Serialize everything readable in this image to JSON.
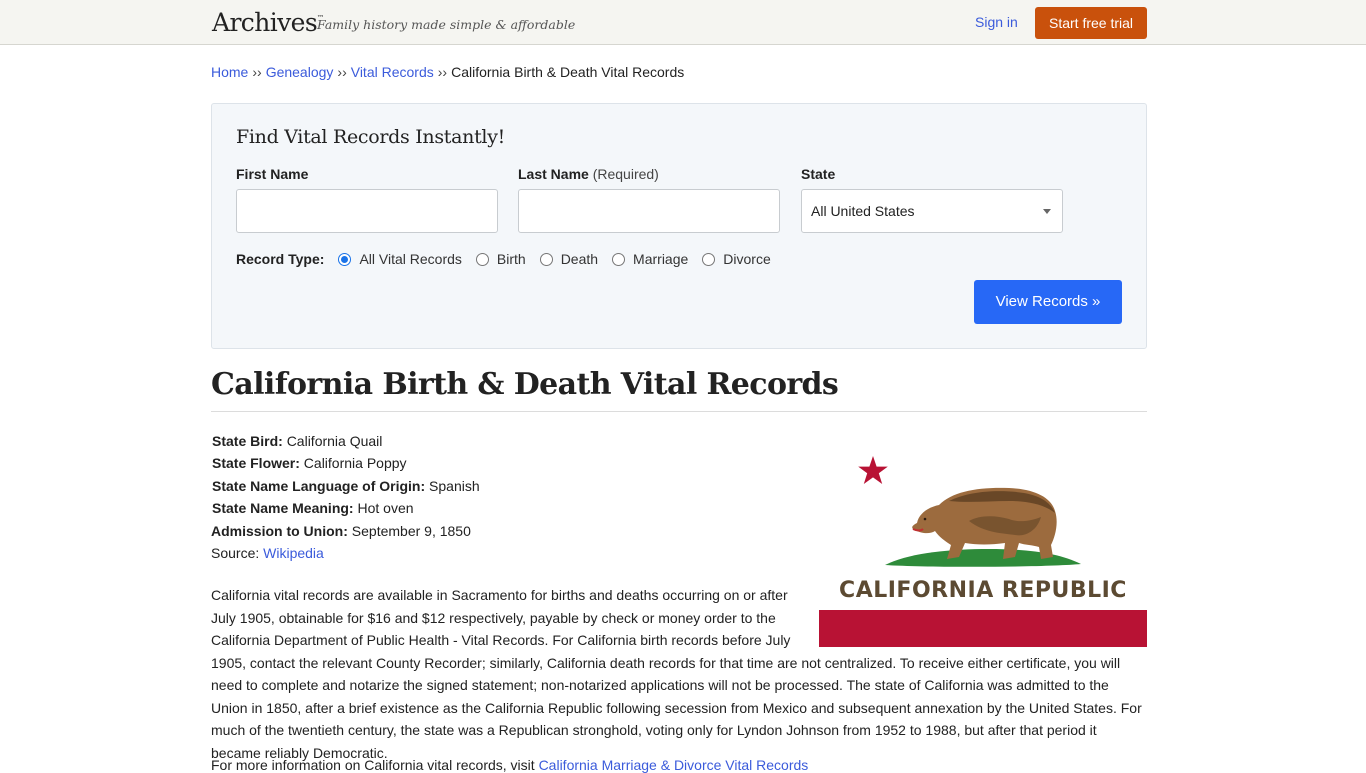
{
  "header": {
    "logo": "Archives",
    "logo_tm": "™",
    "tagline": "Family history made simple & affordable",
    "sign_in": "Sign in",
    "start_trial": "Start free trial",
    "colors": {
      "trial_button": "#c9510c",
      "link": "#3b5bdb"
    }
  },
  "breadcrumb": {
    "separator": "››",
    "items": [
      {
        "label": "Home",
        "link": true
      },
      {
        "label": "Genealogy",
        "link": true
      },
      {
        "label": "Vital Records",
        "link": true
      },
      {
        "label": "California Birth & Death Vital Records",
        "link": false
      }
    ]
  },
  "search": {
    "title": "Find Vital Records Instantly!",
    "first_name": {
      "label": "First Name",
      "value": "",
      "placeholder": ""
    },
    "last_name": {
      "label": "Last Name",
      "hint": "(Required)",
      "value": "",
      "placeholder": ""
    },
    "state": {
      "label": "State",
      "selected": "All United States",
      "icon": "chevron-down-icon"
    },
    "record_type": {
      "label": "Record Type:",
      "options": [
        {
          "label": "All Vital Records",
          "checked": true
        },
        {
          "label": "Birth",
          "checked": false
        },
        {
          "label": "Death",
          "checked": false
        },
        {
          "label": "Marriage",
          "checked": false
        },
        {
          "label": "Divorce",
          "checked": false
        }
      ]
    },
    "submit": "View Records »",
    "colors": {
      "submit_button": "#2768f6"
    }
  },
  "page": {
    "title": "California Birth & Death Vital Records",
    "facts": [
      {
        "label": "State Bird:",
        "value": "California Quail"
      },
      {
        "label": "State Flower:",
        "value": "California Poppy"
      },
      {
        "label": "State Name Language of Origin:",
        "value": "Spanish"
      },
      {
        "label": "State Name Meaning:",
        "value": "Hot oven"
      },
      {
        "label": "Admission to Union:",
        "value": "September 9, 1850"
      }
    ],
    "source_label": "Source:",
    "source_link": "Wikipedia",
    "flag": {
      "caption": "CALIFORNIA REPUBLIC",
      "icon": "california-flag-icon",
      "colors": {
        "red": "#b81234",
        "brown": "#5c4a32",
        "green": "#2e8b3a"
      }
    },
    "body": "California vital records are available in Sacramento for births and deaths occurring on or after July 1905, obtainable for $16 and $12 respectively, payable by check or money order to the California Department of Public Health - Vital Records. For California birth records before July 1905, contact the relevant County Recorder; similarly, California death records for that time are not centralized. To receive either certificate, you will need to complete and notarize the signed statement; non-notarized applications will not be processed. The state of California was admitted to the Union in 1850, after a brief existence as the California Republic following secession from Mexico and subsequent annexation by the United States. For much of the twentieth century, the state was a Republican stronghold, voting only for Lyndon Johnson from 1952 to 1988, but after that period it became reliably Democratic.",
    "more_info_prefix": "For more information on California vital records, visit ",
    "more_info_link": "California Marriage & Divorce Vital Records"
  }
}
